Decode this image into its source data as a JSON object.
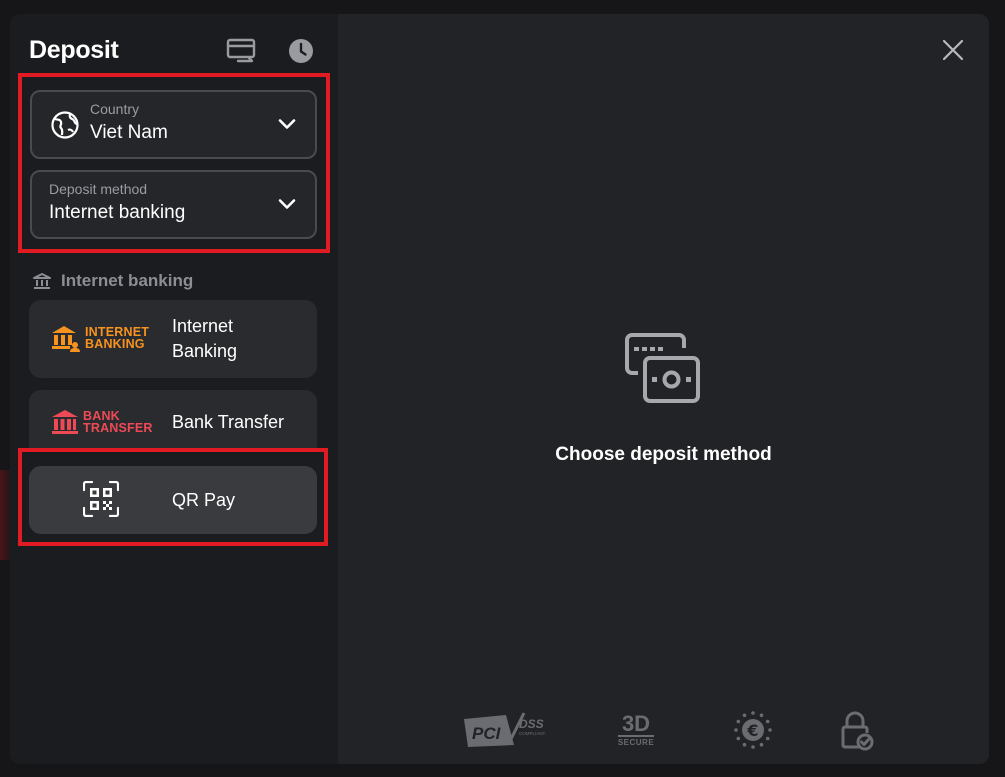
{
  "header": {
    "title": "Deposit"
  },
  "selects": {
    "country": {
      "label": "Country",
      "value": "Viet Nam"
    },
    "method": {
      "label": "Deposit method",
      "value": "Internet banking"
    }
  },
  "section": {
    "title": "Internet banking"
  },
  "methods": [
    {
      "name_line1": "Internet",
      "name_line2": "Banking",
      "logo_line1": "INTERNET",
      "logo_line2": "BANKING",
      "logo_color": "#f7931e"
    },
    {
      "name": "Bank Transfer",
      "logo_line1": "BANK",
      "logo_line2": "TRANSFER",
      "logo_color": "#ee4a55"
    },
    {
      "name": "QR Pay"
    }
  ],
  "main": {
    "empty_text": "Choose deposit method"
  },
  "footer": {
    "pci": "PCI",
    "dss": "DSS",
    "compliant": "COMPLIANT",
    "three_d": "3D",
    "secure": "SECURE"
  },
  "colors": {
    "highlight": "#e01b24",
    "panel": "#1b1c1f",
    "card": "#2a2b2f",
    "muted": "#8d8e95"
  }
}
